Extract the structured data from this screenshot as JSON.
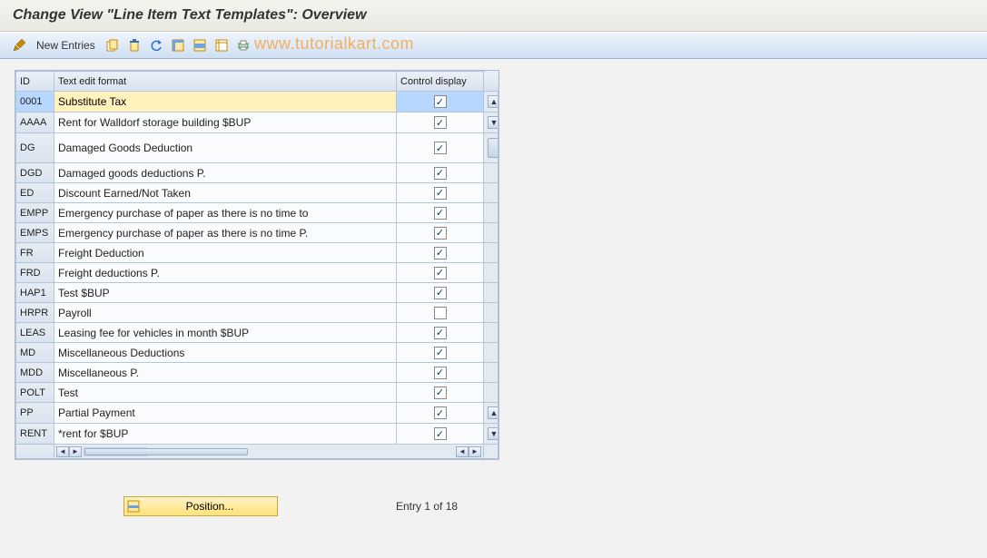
{
  "title": "Change View \"Line Item Text Templates\": Overview",
  "toolbar": {
    "new_entries_label": "New Entries"
  },
  "watermark": "www.tutorialkart.com",
  "columns": {
    "id": "ID",
    "text_format": "Text edit format",
    "control_display": "Control display"
  },
  "rows": [
    {
      "id": "0001",
      "text": "Substitute Tax",
      "ctrl": true
    },
    {
      "id": "AAAA",
      "text": "Rent for Walldorf storage building $BUP",
      "ctrl": true
    },
    {
      "id": "DG",
      "text": "Damaged Goods Deduction",
      "ctrl": true
    },
    {
      "id": "DGD",
      "text": "Damaged goods deductions P.",
      "ctrl": true
    },
    {
      "id": "ED",
      "text": "Discount Earned/Not Taken",
      "ctrl": true
    },
    {
      "id": "EMPP",
      "text": "Emergency purchase of paper as there is no time to",
      "ctrl": true
    },
    {
      "id": "EMPS",
      "text": "Emergency purchase of paper as there is no time P.",
      "ctrl": true
    },
    {
      "id": "FR",
      "text": "Freight Deduction",
      "ctrl": true
    },
    {
      "id": "FRD",
      "text": "Freight deductions P.",
      "ctrl": true
    },
    {
      "id": "HAP1",
      "text": "Test $BUP",
      "ctrl": true
    },
    {
      "id": "HRPR",
      "text": "Payroll",
      "ctrl": false
    },
    {
      "id": "LEAS",
      "text": "Leasing fee for vehicles in month $BUP",
      "ctrl": true
    },
    {
      "id": "MD",
      "text": "Miscellaneous Deductions",
      "ctrl": true
    },
    {
      "id": "MDD",
      "text": "Miscellaneous P.",
      "ctrl": true
    },
    {
      "id": "POLT",
      "text": "Test",
      "ctrl": true
    },
    {
      "id": "PP",
      "text": "Partial Payment",
      "ctrl": true
    },
    {
      "id": "RENT",
      "text": "*rent for $BUP",
      "ctrl": true
    }
  ],
  "footer": {
    "position_label": "Position...",
    "entry_info": "Entry 1 of 18"
  },
  "icons": {
    "wand": "toggle-change-icon",
    "copy": "copy-as-icon",
    "delete": "delete-icon",
    "undo": "undo-icon",
    "select_all": "select-all-icon",
    "select_block": "select-block-icon",
    "deselect": "deselect-all-icon",
    "print": "print-icon",
    "config": "table-settings-icon"
  }
}
